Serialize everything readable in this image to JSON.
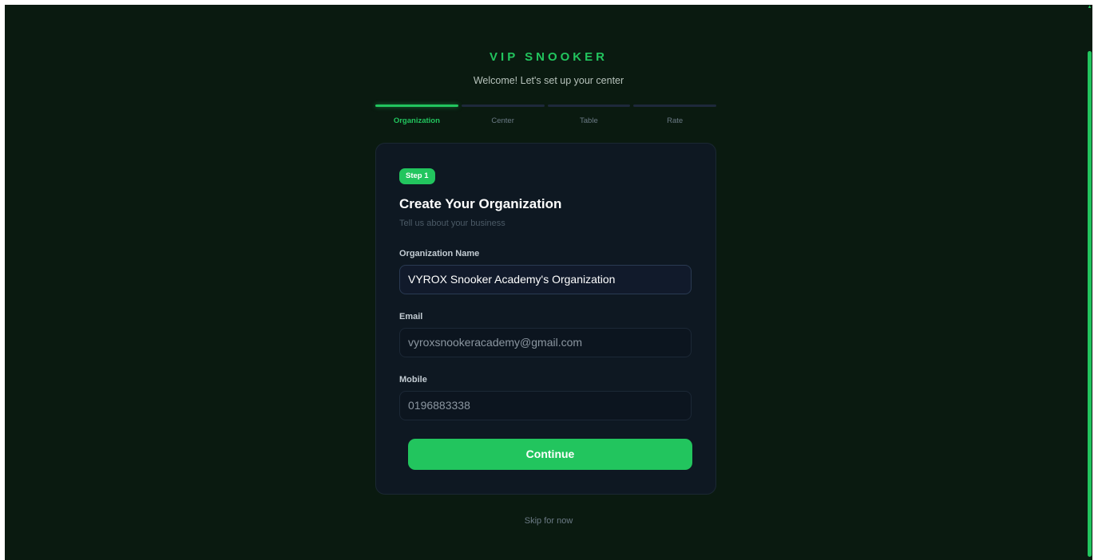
{
  "header": {
    "brand": "VIP SNOOKER",
    "subtitle": "Welcome! Let's set up your center"
  },
  "steps": [
    {
      "label": "Organization",
      "active": true
    },
    {
      "label": "Center",
      "active": false
    },
    {
      "label": "Table",
      "active": false
    },
    {
      "label": "Rate",
      "active": false
    }
  ],
  "form": {
    "badge": "Step 1",
    "title": "Create Your Organization",
    "subtitle": "Tell us about your business",
    "fields": {
      "org_name": {
        "label": "Organization Name",
        "value": "VYROX Snooker Academy's Organization"
      },
      "email": {
        "label": "Email",
        "value": "vyroxsnookeracademy@gmail.com"
      },
      "mobile": {
        "label": "Mobile",
        "value": "0196883338"
      }
    },
    "continue_label": "Continue"
  },
  "footer": {
    "skip_label": "Skip for now"
  },
  "colors": {
    "accent": "#22c55e",
    "background": "#0a1a10",
    "card": "#0e1822"
  },
  "icons": {
    "scroll_up": "triangle-up-icon"
  }
}
